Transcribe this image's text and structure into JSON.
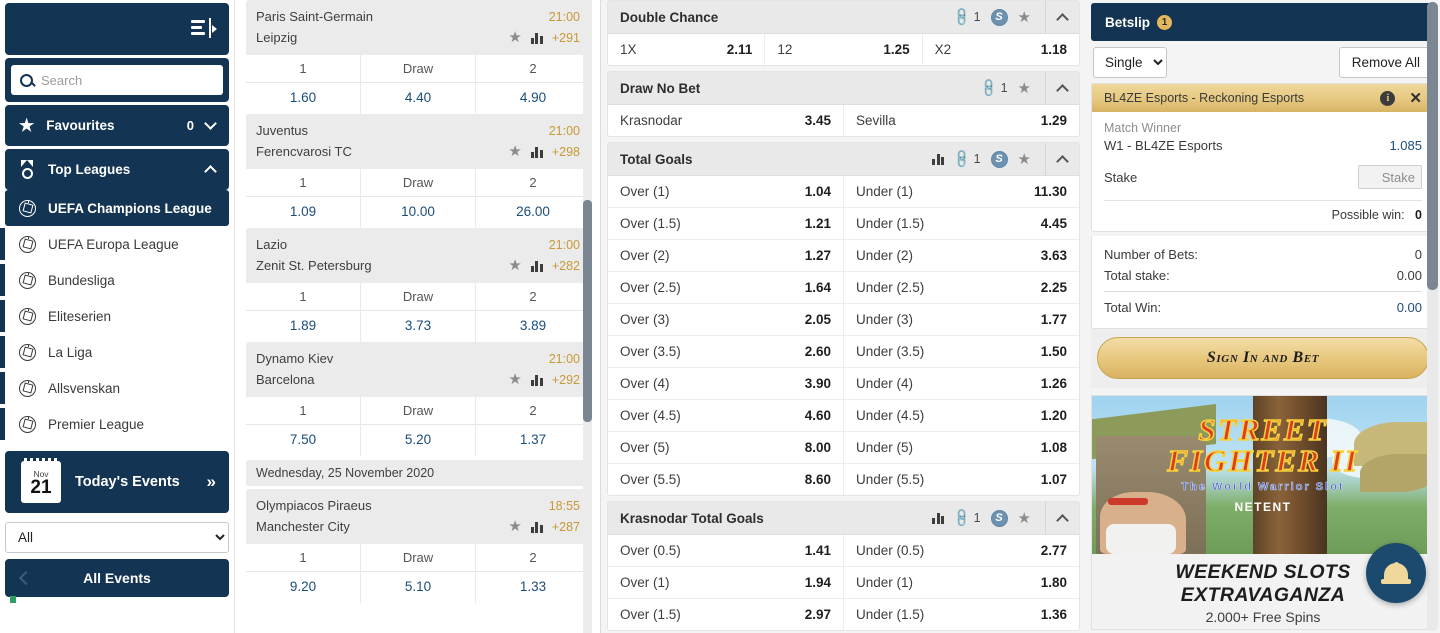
{
  "sidebar": {
    "collapse_icon": "collapse-sidebar-icon",
    "search": {
      "placeholder": "Search",
      "value": "",
      "icon": "search-icon"
    },
    "favourites": {
      "label": "Favourites",
      "count": "0",
      "icon": "star-icon"
    },
    "top_leagues": {
      "label": "Top Leagues",
      "icon": "medal-icon"
    },
    "leagues": [
      {
        "label": "UEFA Champions League",
        "active": true
      },
      {
        "label": "UEFA Europa League",
        "active": false
      },
      {
        "label": "Bundesliga",
        "active": false
      },
      {
        "label": "Eliteserien",
        "active": false
      },
      {
        "label": "La Liga",
        "active": false
      },
      {
        "label": "Allsvenskan",
        "active": false
      },
      {
        "label": "Premier League",
        "active": false
      }
    ],
    "todays_events": {
      "label": "Today's Events",
      "month": "Nov",
      "day": "21",
      "chevron": "double-chevron-right-icon"
    },
    "filter_select": {
      "value": "All",
      "options": [
        "All"
      ]
    },
    "all_events": {
      "label": "All Events",
      "back_icon": "chevron-left-icon"
    }
  },
  "events": {
    "matches": [
      {
        "home": "Paris Saint-Germain",
        "away": "Leipzig",
        "time": "21:00",
        "more": "+291",
        "cols": [
          "1",
          "Draw",
          "2"
        ],
        "odds": [
          "1.60",
          "4.40",
          "4.90"
        ]
      },
      {
        "home": "Juventus",
        "away": "Ferencvarosi TC",
        "time": "21:00",
        "more": "+298",
        "cols": [
          "1",
          "Draw",
          "2"
        ],
        "odds": [
          "1.09",
          "10.00",
          "26.00"
        ]
      },
      {
        "home": "Lazio",
        "away": "Zenit St. Petersburg",
        "time": "21:00",
        "more": "+282",
        "cols": [
          "1",
          "Draw",
          "2"
        ],
        "odds": [
          "1.89",
          "3.73",
          "3.89"
        ]
      },
      {
        "home": "Dynamo Kiev",
        "away": "Barcelona",
        "time": "21:00",
        "more": "+292",
        "cols": [
          "1",
          "Draw",
          "2"
        ],
        "odds": [
          "7.50",
          "5.20",
          "1.37"
        ]
      }
    ],
    "date_divider": "Wednesday, 25 November 2020",
    "matches_after": [
      {
        "home": "Olympiacos Piraeus",
        "away": "Manchester City",
        "time": "18:55",
        "more": "+287",
        "cols": [
          "1",
          "Draw",
          "2"
        ],
        "odds": [
          "9.20",
          "5.10",
          "1.33"
        ]
      }
    ]
  },
  "markets": [
    {
      "title": "Double Chance",
      "link_count": "1",
      "has_stats": false,
      "has_cashout": true,
      "rows": [
        [
          {
            "name": "1X",
            "odd": "2.11"
          },
          {
            "name": "12",
            "odd": "1.25"
          },
          {
            "name": "X2",
            "odd": "1.18"
          }
        ]
      ]
    },
    {
      "title": "Draw No Bet",
      "link_count": "1",
      "has_stats": false,
      "has_cashout": false,
      "rows": [
        [
          {
            "name": "Krasnodar",
            "odd": "3.45"
          },
          {
            "name": "Sevilla",
            "odd": "1.29"
          }
        ]
      ]
    },
    {
      "title": "Total Goals",
      "link_count": "1",
      "has_stats": true,
      "has_cashout": true,
      "rows": [
        [
          {
            "name": "Over (1)",
            "odd": "1.04"
          },
          {
            "name": "Under (1)",
            "odd": "11.30"
          }
        ],
        [
          {
            "name": "Over (1.5)",
            "odd": "1.21"
          },
          {
            "name": "Under (1.5)",
            "odd": "4.45"
          }
        ],
        [
          {
            "name": "Over (2)",
            "odd": "1.27"
          },
          {
            "name": "Under (2)",
            "odd": "3.63"
          }
        ],
        [
          {
            "name": "Over (2.5)",
            "odd": "1.64"
          },
          {
            "name": "Under (2.5)",
            "odd": "2.25"
          }
        ],
        [
          {
            "name": "Over (3)",
            "odd": "2.05"
          },
          {
            "name": "Under (3)",
            "odd": "1.77"
          }
        ],
        [
          {
            "name": "Over (3.5)",
            "odd": "2.60"
          },
          {
            "name": "Under (3.5)",
            "odd": "1.50"
          }
        ],
        [
          {
            "name": "Over (4)",
            "odd": "3.90"
          },
          {
            "name": "Under (4)",
            "odd": "1.26"
          }
        ],
        [
          {
            "name": "Over (4.5)",
            "odd": "4.60"
          },
          {
            "name": "Under (4.5)",
            "odd": "1.20"
          }
        ],
        [
          {
            "name": "Over (5)",
            "odd": "8.00"
          },
          {
            "name": "Under (5)",
            "odd": "1.08"
          }
        ],
        [
          {
            "name": "Over (5.5)",
            "odd": "8.60"
          },
          {
            "name": "Under (5.5)",
            "odd": "1.07"
          }
        ]
      ]
    },
    {
      "title": "Krasnodar Total Goals",
      "link_count": "1",
      "has_stats": true,
      "has_cashout": true,
      "rows": [
        [
          {
            "name": "Over (0.5)",
            "odd": "1.41"
          },
          {
            "name": "Under (0.5)",
            "odd": "2.77"
          }
        ],
        [
          {
            "name": "Over (1)",
            "odd": "1.94"
          },
          {
            "name": "Under (1)",
            "odd": "1.80"
          }
        ],
        [
          {
            "name": "Over (1.5)",
            "odd": "2.97"
          },
          {
            "name": "Under (1.5)",
            "odd": "1.36"
          }
        ]
      ]
    }
  ],
  "betslip": {
    "title": "Betslip",
    "count": "1",
    "bet_type": {
      "value": "Single",
      "options": [
        "Single"
      ]
    },
    "remove_all": "Remove All",
    "bet": {
      "event": "BL4ZE Esports - Reckoning Esports",
      "market": "Match Winner",
      "selection": "W1 - BL4ZE Esports",
      "odds": "1.085",
      "stake_label": "Stake",
      "stake_placeholder": "Stake",
      "stake_value": "",
      "possible_win_label": "Possible win:",
      "possible_win": "0",
      "info_icon": "info-icon",
      "close_icon": "close-icon"
    },
    "totals": [
      {
        "label": "Number of Bets:",
        "value": "0"
      },
      {
        "label": "Total stake:",
        "value": "0.00"
      }
    ],
    "total_win": {
      "label": "Total Win:",
      "value": "0.00"
    },
    "submit": "Sign In and Bet"
  },
  "promo": {
    "logo_line1": "STREET",
    "logo_line2": "FIGHTER II",
    "logo_sub": "The World Warrior Slot",
    "provider": "NETENT",
    "title": "WEEKEND SLOTS EXTRAVAGANZA",
    "subtitle": "2.000+ Free Spins",
    "support_icon": "bell-icon"
  },
  "colors": {
    "navy": "#133452",
    "gold": "#c79a36",
    "odds_blue": "#1b4d7a",
    "badge": "#e3b75c"
  }
}
